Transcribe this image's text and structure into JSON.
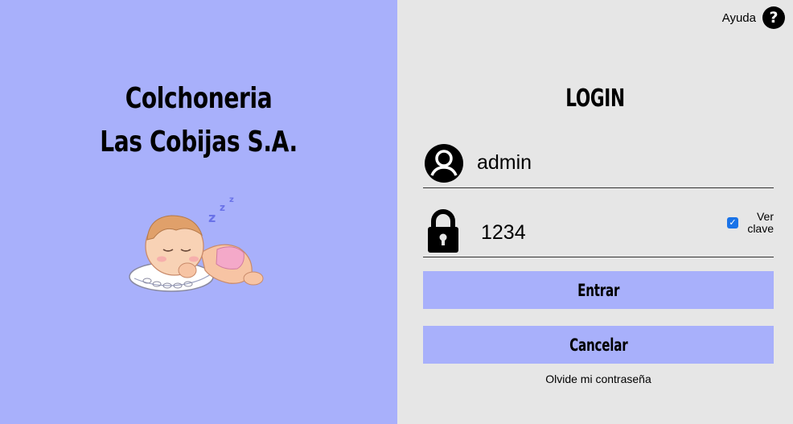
{
  "brand": {
    "line1": "Colchoneria",
    "line2": "Las Cobijas S.A."
  },
  "header": {
    "help_label": "Ayuda",
    "help_icon": "question-circle-icon"
  },
  "login": {
    "title": "LOGIN",
    "username_value": "admin",
    "password_value": "1234",
    "show_password_label_line1": "Ver",
    "show_password_label_line2": "clave",
    "show_password_checked": true,
    "enter_label": "Entrar",
    "cancel_label": "Cancelar",
    "forgot_label": "Olvide mi contraseña"
  },
  "colors": {
    "left_panel": "#a8b0fb",
    "right_panel": "#e6e6e6",
    "button": "#a8b0fb",
    "checkbox": "#1a73e8"
  }
}
